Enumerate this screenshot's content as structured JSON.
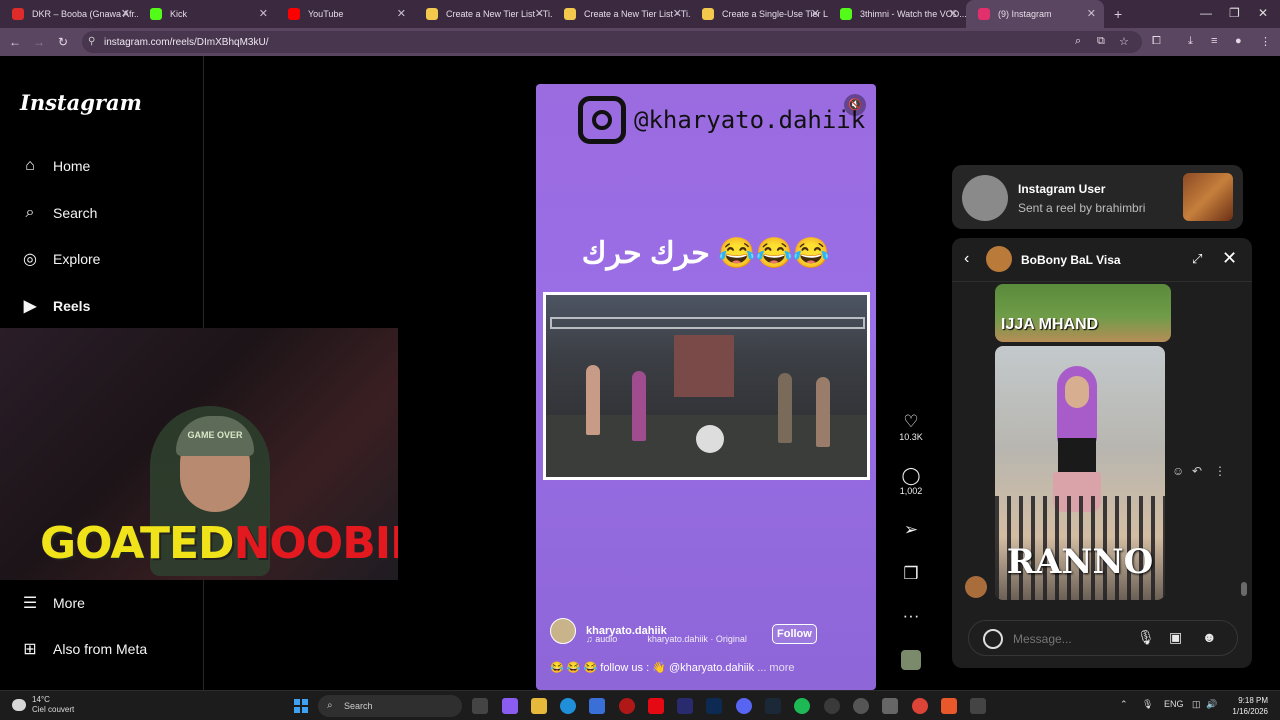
{
  "browser": {
    "tabs": [
      {
        "title": "DKR – Booba (Gnawa Afr...",
        "color": "#e02b2b"
      },
      {
        "title": "Kick",
        "color": "#53fc18"
      },
      {
        "title": "YouTube",
        "color": "#ff0000"
      },
      {
        "title": "Create a New Tier List - Ti...",
        "color": "#f2c94c"
      },
      {
        "title": "Create a New Tier List - Ti...",
        "color": "#f2c94c"
      },
      {
        "title": "Create a Single-Use Tier L...",
        "color": "#f2c94c"
      },
      {
        "title": "3thimni - Watch the VOD...",
        "color": "#53fc18"
      },
      {
        "title": "(9) Instagram",
        "color": "#e1306c"
      }
    ],
    "url": "instagram.com/reels/DImXBhqM3kU/"
  },
  "sidebar": {
    "logo": "Instagram",
    "items": [
      {
        "label": "Home",
        "icon": "home-icon",
        "glyph": "⌂"
      },
      {
        "label": "Search",
        "icon": "search-icon",
        "glyph": "⌕"
      },
      {
        "label": "Explore",
        "icon": "compass-icon",
        "glyph": "◎"
      },
      {
        "label": "Reels",
        "icon": "reels-icon",
        "glyph": "▶"
      }
    ],
    "bottom": [
      {
        "label": "More",
        "icon": "menu-icon",
        "glyph": "☰"
      },
      {
        "label": "Also from Meta",
        "icon": "meta-icon",
        "glyph": "⊞"
      }
    ]
  },
  "webcam": {
    "cap_text": "GAME OVER",
    "brand_yellow": "GOATED",
    "brand_red": "NOOBIE"
  },
  "reel": {
    "overlay_handle": "@kharyato.dahiik",
    "caption_arabic": "حرك حرك 😂😂😂",
    "author": "kharyato.dahiik",
    "audio_label": "audio",
    "audio_title": "kharyato.dahiik · Original",
    "follow_label": "Follow",
    "description": "😂 😂 😂 follow us : 👋 @kharyato.dahiik",
    "more_label": "... more",
    "likes": "10.3K",
    "comments": "1,002"
  },
  "notification": {
    "title": "Instagram User",
    "subtitle": "Sent a reel by brahimbri"
  },
  "chat": {
    "title": "BoBony BaL Visa",
    "msg1_label": "IJJA MHAND",
    "msg2_label": "RANNO",
    "message_placeholder": "Message..."
  },
  "taskbar": {
    "temp": "14°C",
    "weather": "Ciel couvert",
    "search": "Search",
    "lang": "ENG",
    "time": "9:18 PM",
    "date": "1/16/2026"
  }
}
